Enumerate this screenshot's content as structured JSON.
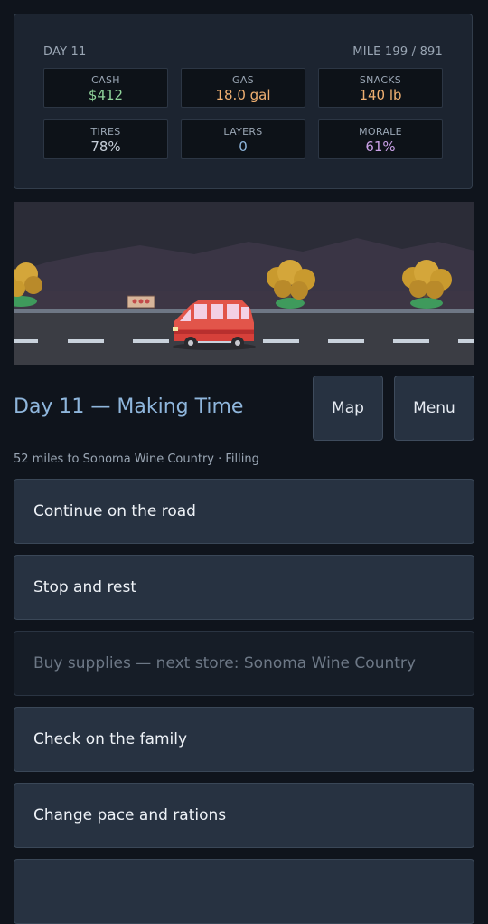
{
  "status": {
    "day_label": "DAY 11",
    "mile_label": "MILE 199 / 891",
    "stats": [
      {
        "label": "CASH",
        "value": "$412",
        "color": "#8fd39a"
      },
      {
        "label": "GAS",
        "value": "18.0 gal",
        "color": "#f0b072"
      },
      {
        "label": "SNACKS",
        "value": "140 lb",
        "color": "#f0b072"
      },
      {
        "label": "TIRES",
        "value": "78%",
        "color": "#c6ced8"
      },
      {
        "label": "LAYERS",
        "value": "0",
        "color": "#8fb6dc"
      },
      {
        "label": "MORALE",
        "value": "61%",
        "color": "#c9a0e6"
      }
    ]
  },
  "header": {
    "title": "Day 11 — Making Time",
    "map_label": "Map",
    "menu_label": "Menu",
    "subtitle": "52 miles to Sonoma Wine Country · Filling"
  },
  "actions": [
    {
      "label": "Continue on the road",
      "enabled": true
    },
    {
      "label": "Stop and rest",
      "enabled": true
    },
    {
      "label": "Buy supplies — next store: Sonoma Wine Country",
      "enabled": false
    },
    {
      "label": "Check on the family",
      "enabled": true
    },
    {
      "label": "Change pace and rations",
      "enabled": true
    }
  ]
}
